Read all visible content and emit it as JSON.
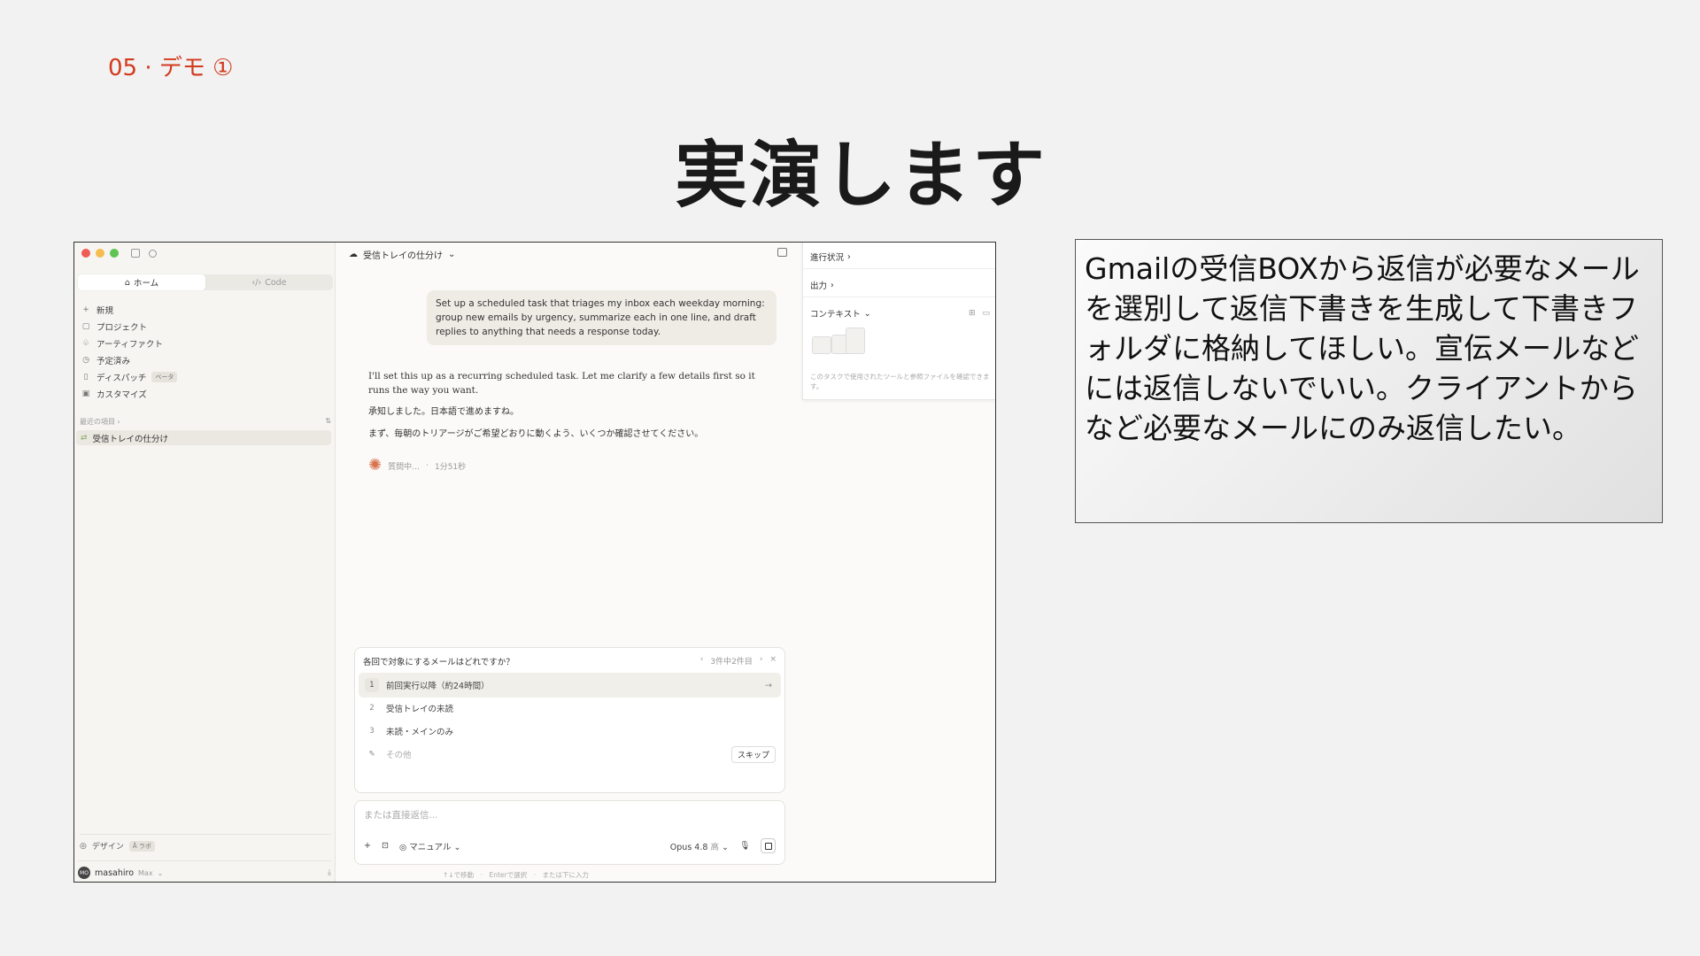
{
  "slide": {
    "label": "05 · デモ ①",
    "title": "実演します",
    "note": "Gmailの受信BOXから返信が必要なメールを選別して返信下書きを生成して下書きフォルダに格納してほしい。宣伝メールなどには返信しないでいい。クライアントからなど必要なメールにのみ返信したい。"
  },
  "sidebar": {
    "modes": [
      {
        "icon": "⌂",
        "label": "ホーム"
      },
      {
        "icon": "‹/›",
        "label": "Code"
      }
    ],
    "nav": [
      {
        "icon": "+",
        "label": "新規"
      },
      {
        "icon": "▢",
        "label": "プロジェクト"
      },
      {
        "icon": "♧",
        "label": "アーティファクト"
      },
      {
        "icon": "◷",
        "label": "予定済み"
      },
      {
        "icon": "▯",
        "label": "ディスパッチ",
        "tag": "ベータ"
      },
      {
        "icon": "▣",
        "label": "カスタマイズ"
      }
    ],
    "recent_label": "最近の項目 ›",
    "recent_items": [
      {
        "label": "受信トレイの仕分け"
      }
    ],
    "design_label": "デザイン",
    "design_tag": "Å ラボ",
    "user": {
      "initials": "MO",
      "name": "masahiro",
      "plan": "Max"
    }
  },
  "main": {
    "title": "受信トレイの仕分け",
    "user_message": "Set up a scheduled task that triages my inbox each weekday morning: group new emails by urgency, summarize each in one line, and draft replies to anything that needs a response today.",
    "assistant": [
      "I'll set this up as a recurring scheduled task. Let me clarify a few details first so it runs the way you want.",
      "承知しました。日本語で進めますね。",
      "まず、毎朝のトリアージがご希望どおりに動くよう、いくつか確認させてください。"
    ],
    "status": "質問中…",
    "elapsed": "1分51秒",
    "question": {
      "text": "各回で対象にするメールはどれですか？",
      "pager": "3件中2件目",
      "options": [
        {
          "num": "1",
          "label": "前回実行以降（約24時間）"
        },
        {
          "num": "2",
          "label": "受信トレイの未読"
        },
        {
          "num": "3",
          "label": "未読・メインのみ"
        }
      ],
      "other": "その他",
      "skip": "スキップ"
    },
    "composer": {
      "placeholder": "または直接返信...",
      "mode": "マニュアル",
      "model": "Opus 4.8",
      "effort": "高"
    },
    "hint": "↑↓で移動　·　Enterで選択　·　または下に入力"
  },
  "right_panel": {
    "progress": "進行状況",
    "output": "出力",
    "context": "コンテキスト",
    "context_desc": "このタスクで使用されたツールと参照ファイルを確認できます。"
  },
  "colors": {
    "accent": "#d23a1e",
    "spark": "#d9734e"
  }
}
